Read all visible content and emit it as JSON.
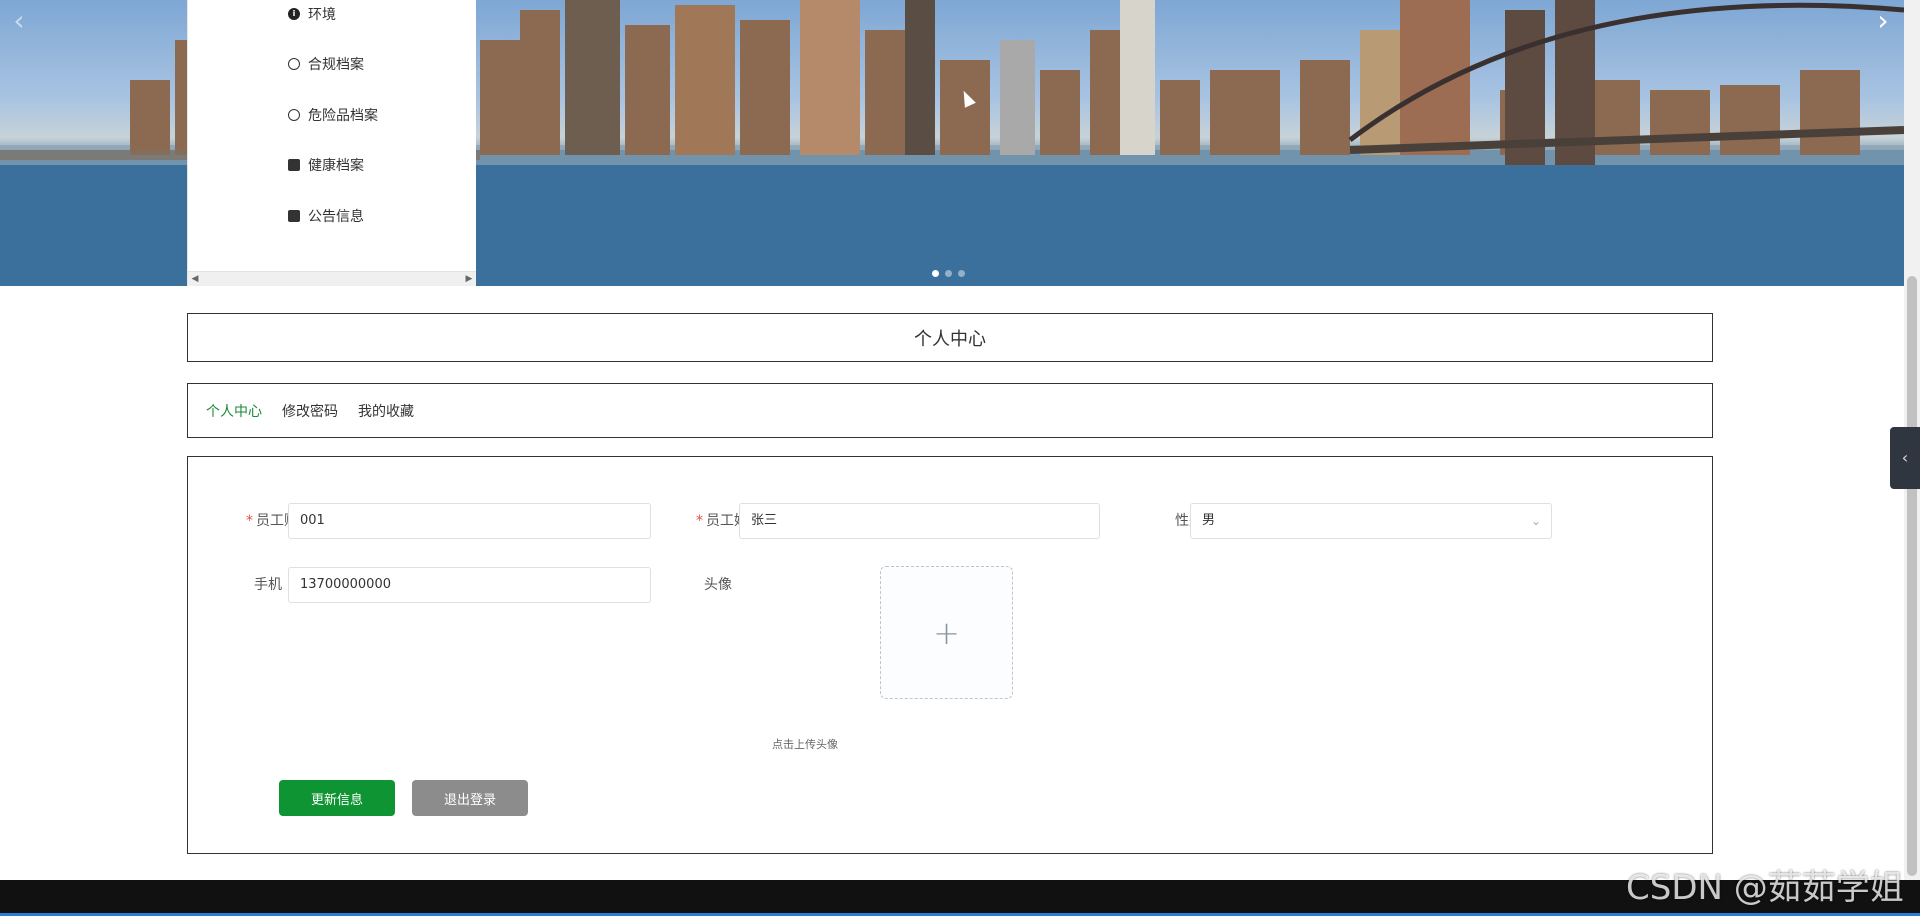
{
  "banner": {
    "prev_icon": "chevron-left-icon",
    "next_icon": "chevron-right-icon",
    "slide_count": 3,
    "active_slide": 1
  },
  "side_menu": {
    "items": [
      {
        "label": "环境",
        "icon": "info-icon"
      },
      {
        "label": "合规档案",
        "icon": "circle-icon"
      },
      {
        "label": "危险品档案",
        "icon": "circle-icon"
      },
      {
        "label": "健康档案",
        "icon": "camera-icon"
      },
      {
        "label": "公告信息",
        "icon": "car-icon"
      }
    ]
  },
  "page": {
    "title": "个人中心",
    "tabs": [
      {
        "label": "个人中心",
        "active": true
      },
      {
        "label": "修改密码",
        "active": false
      },
      {
        "label": "我的收藏",
        "active": false
      }
    ]
  },
  "form": {
    "account": {
      "label": "员工账号",
      "value": "001",
      "required": true
    },
    "name": {
      "label": "员工姓名",
      "value": "张三",
      "required": true
    },
    "gender": {
      "label": "性别",
      "value": "男"
    },
    "phone": {
      "label": "手机",
      "value": "13700000000"
    },
    "avatar": {
      "label": "头像",
      "upload_symbol": "+",
      "hint": "点击上传头像"
    },
    "update_button": "更新信息",
    "logout_button": "退出登录"
  },
  "colors": {
    "accent_green": "#0e9433",
    "active_tab": "#1b8a3a",
    "logout_gray": "#8c8c8c",
    "required_star": "#e54d42"
  },
  "watermark": "CSDN @茹茹学姐"
}
